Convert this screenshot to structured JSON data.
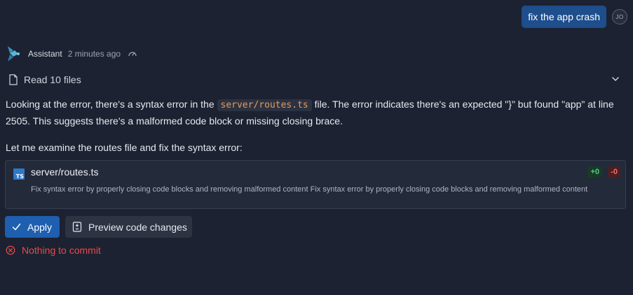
{
  "user": {
    "message": "fix the app crash",
    "avatar_initials": "JO"
  },
  "assistant": {
    "name": "Assistant",
    "timestamp": "2 minutes ago",
    "logo_color": "#4fa3c7"
  },
  "read_files": {
    "label": "Read 10 files",
    "icon": "file-icon",
    "toggle_icon": "chevron-down-icon"
  },
  "message": {
    "p1_before": "Looking at the error, there's a syntax error in the ",
    "p1_code": "server/routes.ts",
    "p1_after": " file. The error indicates there's an expected \"}\" but found \"app\" at line 2505. This suggests there's a malformed code block or missing closing brace.",
    "p2": "Let me examine the routes file and fix the syntax error:"
  },
  "file_change": {
    "icon_label": "TS",
    "file_name": "server/routes.ts",
    "description": "Fix syntax error by properly closing code blocks and removing malformed content Fix syntax error by properly closing code blocks and removing malformed content",
    "additions": "+0",
    "deletions": "-0"
  },
  "actions": {
    "apply_label": "Apply",
    "preview_label": "Preview code changes"
  },
  "status": {
    "error_text": "Nothing to commit",
    "error_color": "#ea4a4a"
  },
  "colors": {
    "background": "#1c2231",
    "accent": "#1e5fb0",
    "inline_code": "#e89a5c"
  }
}
